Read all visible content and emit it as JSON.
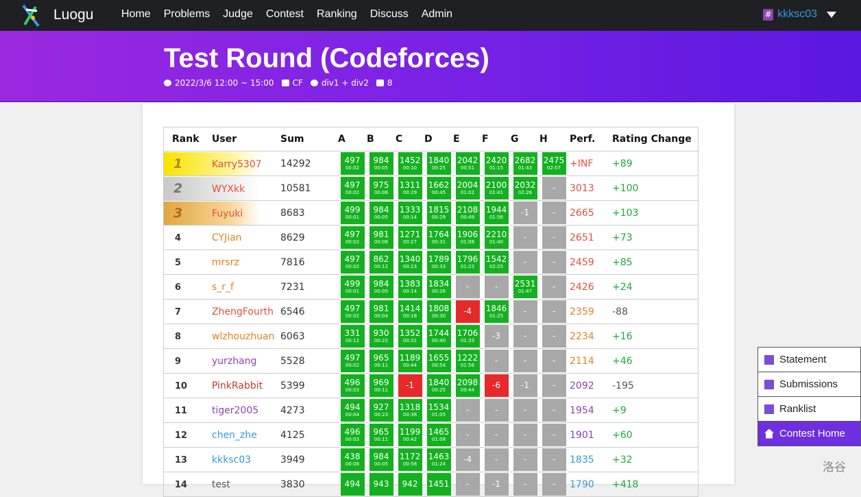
{
  "nav": {
    "brand": "Luogu",
    "links": [
      "Home",
      "Problems",
      "Judge",
      "Contest",
      "Ranking",
      "Discuss",
      "Admin"
    ],
    "user": "kkksc03",
    "user_badge": "#"
  },
  "contest": {
    "title": "Test Round (Codeforces)",
    "time": "2022/3/6 12:00 ~ 15:00",
    "type": "CF",
    "division": "div1 + div2",
    "problem_count": "8"
  },
  "table": {
    "headers": {
      "rank": "Rank",
      "user": "User",
      "sum": "Sum",
      "perf": "Perf.",
      "rating": "Rating Change"
    },
    "problems": [
      "A",
      "B",
      "C",
      "D",
      "E",
      "F",
      "G",
      "H"
    ],
    "rows": [
      {
        "rank": "1",
        "user": "Karry5307",
        "user_color": "#e74c3c",
        "sum": "14292",
        "cells": [
          [
            "497",
            "00:02"
          ],
          [
            "984",
            "00:05"
          ],
          [
            "1452",
            "00:10"
          ],
          [
            "1840",
            "00:25"
          ],
          [
            "2042",
            "00:51"
          ],
          [
            "2420",
            "01:15"
          ],
          [
            "2682",
            "01:43"
          ],
          [
            "2475",
            "02:07"
          ]
        ],
        "perf": "+INF",
        "perf_color": "#e74c3c",
        "delta": "+89"
      },
      {
        "rank": "2",
        "user": "WYXkk",
        "user_color": "#e74c3c",
        "sum": "10581",
        "cells": [
          [
            "497",
            "00:02"
          ],
          [
            "975",
            "00:08"
          ],
          [
            "1311",
            "00:29"
          ],
          [
            "1662",
            "00:45"
          ],
          [
            "2004",
            "01:02"
          ],
          [
            "2100",
            "01:41"
          ],
          [
            "2032",
            "02:26"
          ],
          [
            "-",
            ""
          ]
        ],
        "perf": "3013",
        "perf_color": "#e74c3c",
        "delta": "+100"
      },
      {
        "rank": "3",
        "user": "Fuyuki",
        "user_color": "#e74c3c",
        "sum": "8683",
        "cells": [
          [
            "499",
            "00:01"
          ],
          [
            "984",
            "00:05"
          ],
          [
            "1333",
            "00:14"
          ],
          [
            "1815",
            "00:29"
          ],
          [
            "2108",
            "00:49"
          ],
          [
            "1944",
            "01:56"
          ],
          [
            "-1",
            ""
          ],
          [
            "-",
            ""
          ]
        ],
        "perf": "2665",
        "perf_color": "#e74c3c",
        "delta": "+103"
      },
      {
        "rank": "4",
        "user": "CYJian",
        "user_color": "#e67e22",
        "sum": "8629",
        "cells": [
          [
            "497",
            "00:02"
          ],
          [
            "981",
            "00:06"
          ],
          [
            "1271",
            "00:27"
          ],
          [
            "1764",
            "00:31"
          ],
          [
            "1906",
            "01:08"
          ],
          [
            "2210",
            "01:40"
          ],
          [
            "-",
            ""
          ],
          [
            "-",
            ""
          ]
        ],
        "perf": "2651",
        "perf_color": "#e74c3c",
        "delta": "+73"
      },
      {
        "rank": "5",
        "user": "mrsrz",
        "user_color": "#e67e22",
        "sum": "7816",
        "cells": [
          [
            "497",
            "00:02"
          ],
          [
            "862",
            "00:12"
          ],
          [
            "1340",
            "00:23"
          ],
          [
            "1789",
            "00:33"
          ],
          [
            "1796",
            "01:23"
          ],
          [
            "1542",
            "02:25"
          ],
          [
            "-",
            ""
          ],
          [
            "-",
            ""
          ]
        ],
        "perf": "2459",
        "perf_color": "#e74c3c",
        "delta": "+85"
      },
      {
        "rank": "6",
        "user": "s_r_f",
        "user_color": "#e67e22",
        "sum": "7231",
        "cells": [
          [
            "499",
            "00:01"
          ],
          [
            "984",
            "00:05"
          ],
          [
            "1383",
            "00:14"
          ],
          [
            "1834",
            "00:26"
          ],
          [
            "-",
            ""
          ],
          [
            "-",
            ""
          ],
          [
            "2531",
            "01:47"
          ],
          [
            "-",
            ""
          ]
        ],
        "perf": "2426",
        "perf_color": "#e74c3c",
        "delta": "+24"
      },
      {
        "rank": "7",
        "user": "ZhengFourth",
        "user_color": "#e74c3c",
        "sum": "6546",
        "cells": [
          [
            "497",
            "00:02"
          ],
          [
            "981",
            "00:04"
          ],
          [
            "1414",
            "00:18"
          ],
          [
            "1808",
            "00:30"
          ],
          [
            "-4",
            "wa"
          ],
          [
            "1846",
            "01:25"
          ],
          [
            "-",
            ""
          ],
          [
            "-",
            ""
          ]
        ],
        "perf": "2359",
        "perf_color": "#e67e22",
        "delta": "-88"
      },
      {
        "rank": "8",
        "user": "wlzhouzhuan",
        "user_color": "#e67e22",
        "sum": "6063",
        "cells": [
          [
            "331",
            "00:12"
          ],
          [
            "930",
            "00:22"
          ],
          [
            "1352",
            "00:31"
          ],
          [
            "1744",
            "00:40"
          ],
          [
            "1706",
            "01:33"
          ],
          [
            "-3",
            ""
          ],
          [
            "-",
            ""
          ],
          [
            "-",
            ""
          ]
        ],
        "perf": "2234",
        "perf_color": "#e67e22",
        "delta": "+16"
      },
      {
        "rank": "9",
        "user": "yurzhang",
        "user_color": "#8e44ad",
        "sum": "5528",
        "cells": [
          [
            "497",
            "00:02"
          ],
          [
            "965",
            "00:11"
          ],
          [
            "1189",
            "00:44"
          ],
          [
            "1655",
            "00:54"
          ],
          [
            "1222",
            "01:56"
          ],
          [
            "-",
            ""
          ],
          [
            "-",
            ""
          ],
          [
            "-",
            ""
          ]
        ],
        "perf": "2114",
        "perf_color": "#e67e22",
        "delta": "+46"
      },
      {
        "rank": "10",
        "user": "PinkRabbit",
        "user_color": "#c0392b",
        "sum": "5399",
        "cells": [
          [
            "496",
            "00:03"
          ],
          [
            "969",
            "00:11"
          ],
          [
            "-1",
            "wa"
          ],
          [
            "1840",
            "00:25"
          ],
          [
            "2098",
            "00:44"
          ],
          [
            "-6",
            "wa"
          ],
          [
            "-1",
            ""
          ],
          [
            "-",
            ""
          ]
        ],
        "perf": "2092",
        "perf_color": "#8e44ad",
        "delta": "-195"
      },
      {
        "rank": "11",
        "user": "tiger2005",
        "user_color": "#8e44ad",
        "sum": "4273",
        "cells": [
          [
            "494",
            "00:04"
          ],
          [
            "927",
            "00:23"
          ],
          [
            "1318",
            "00:38"
          ],
          [
            "1534",
            "01:05"
          ],
          [
            "-",
            ""
          ],
          [
            "-",
            ""
          ],
          [
            "-",
            ""
          ],
          [
            "-",
            ""
          ]
        ],
        "perf": "1954",
        "perf_color": "#8e44ad",
        "delta": "+9"
      },
      {
        "rank": "12",
        "user": "chen_zhe",
        "user_color": "#3498db",
        "sum": "4125",
        "cells": [
          [
            "496",
            "00:03"
          ],
          [
            "965",
            "00:11"
          ],
          [
            "1199",
            "00:42"
          ],
          [
            "1465",
            "01:08"
          ],
          [
            "-",
            ""
          ],
          [
            "-",
            ""
          ],
          [
            "-",
            ""
          ],
          [
            "-",
            ""
          ]
        ],
        "perf": "1901",
        "perf_color": "#8e44ad",
        "delta": "+60"
      },
      {
        "rank": "13",
        "user": "kkksc03",
        "user_color": "#3498db",
        "sum": "3949",
        "cells": [
          [
            "438",
            "00:08"
          ],
          [
            "984",
            "00:05"
          ],
          [
            "1172",
            "00:58"
          ],
          [
            "1463",
            "01:24"
          ],
          [
            "-4",
            ""
          ],
          [
            "-",
            ""
          ],
          [
            "-",
            ""
          ],
          [
            "-",
            ""
          ]
        ],
        "perf": "1835",
        "perf_color": "#3498db",
        "delta": "+32"
      },
      {
        "rank": "14",
        "user": "test",
        "user_color": "#555555",
        "sum": "3830",
        "cells": [
          [
            "494",
            ""
          ],
          [
            "943",
            ""
          ],
          [
            "942",
            ""
          ],
          [
            "1451",
            ""
          ],
          [
            "-",
            ""
          ],
          [
            "-1",
            ""
          ],
          [
            "-",
            ""
          ],
          [
            "-",
            ""
          ]
        ],
        "perf": "1790",
        "perf_color": "#3498db",
        "delta": "+418"
      }
    ]
  },
  "side_buttons": [
    "Statement",
    "Submissions",
    "Ranklist",
    "Contest Home"
  ],
  "watermark": "洛谷"
}
